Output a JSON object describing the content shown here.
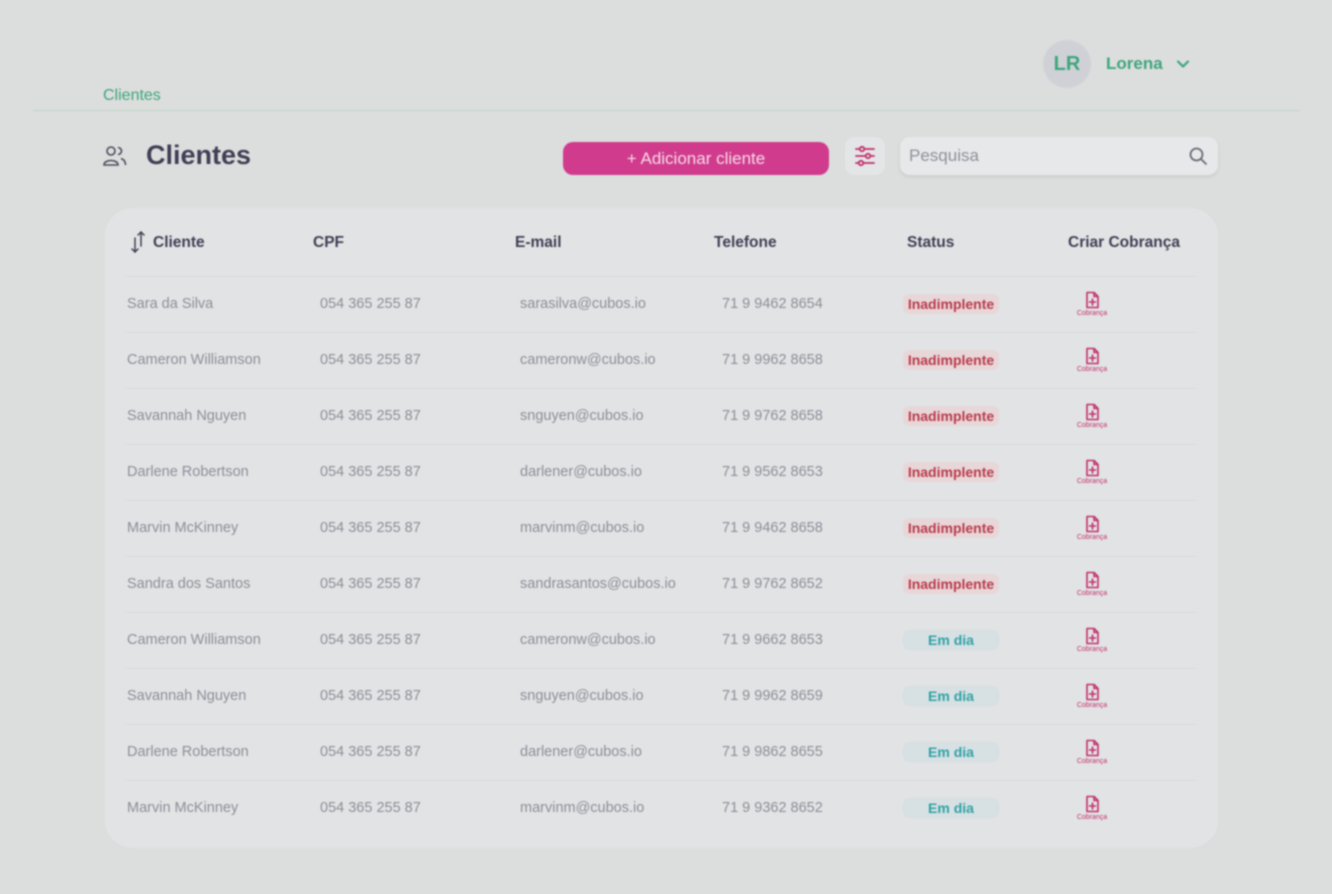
{
  "breadcrumb": "Clientes",
  "user": {
    "initials": "LR",
    "name": "Lorena"
  },
  "page": {
    "title": "Clientes"
  },
  "actions": {
    "add_client": "+ Adicionar cliente"
  },
  "search": {
    "placeholder": "Pesquisa"
  },
  "table": {
    "headers": {
      "client": "Cliente",
      "cpf": "CPF",
      "email": "E-mail",
      "phone": "Telefone",
      "status": "Status",
      "charge": "Criar Cobrança"
    },
    "charge_label": "Cobrança",
    "rows": [
      {
        "name": "Sara da Silva",
        "cpf": "054 365 255 87",
        "email": "sarasilva@cubos.io",
        "phone": "71 9 9462 8654",
        "status": "Inadimplente"
      },
      {
        "name": "Cameron Williamson",
        "cpf": "054 365 255 87",
        "email": "cameronw@cubos.io",
        "phone": "71 9 9962 8658",
        "status": "Inadimplente"
      },
      {
        "name": "Savannah Nguyen",
        "cpf": "054 365 255 87",
        "email": "snguyen@cubos.io",
        "phone": "71 9 9762 8658",
        "status": "Inadimplente"
      },
      {
        "name": "Darlene Robertson",
        "cpf": "054 365 255 87",
        "email": "darlener@cubos.io",
        "phone": "71 9 9562 8653",
        "status": "Inadimplente"
      },
      {
        "name": "Marvin McKinney",
        "cpf": "054 365 255 87",
        "email": "marvinm@cubos.io",
        "phone": "71 9 9462 8658",
        "status": "Inadimplente"
      },
      {
        "name": "Sandra dos Santos",
        "cpf": "054 365 255 87",
        "email": "sandrasantos@cubos.io",
        "phone": "71 9 9762 8652",
        "status": "Inadimplente"
      },
      {
        "name": "Cameron Williamson",
        "cpf": "054 365 255 87",
        "email": "cameronw@cubos.io",
        "phone": "71 9 9662 8653",
        "status": "Em dia"
      },
      {
        "name": "Savannah Nguyen",
        "cpf": "054 365 255 87",
        "email": "snguyen@cubos.io",
        "phone": "71 9 9962 8659",
        "status": "Em dia"
      },
      {
        "name": "Darlene Robertson",
        "cpf": "054 365 255 87",
        "email": "darlener@cubos.io",
        "phone": "71 9 9862 8655",
        "status": "Em dia"
      },
      {
        "name": "Marvin McKinney",
        "cpf": "054 365 255 87",
        "email": "marvinm@cubos.io",
        "phone": "71 9 9362 8652",
        "status": "Em dia"
      }
    ]
  },
  "colors": {
    "accent": "#d13b8d",
    "brand_green": "#3fa57c",
    "overdue": "#b93a4b",
    "on_time": "#2fa2a6"
  },
  "icons": {
    "clients": "users-icon",
    "filter": "sliders-icon",
    "search": "search-icon",
    "sort": "sort-icon",
    "charge": "document-icon",
    "dropdown": "chevron-down-icon"
  }
}
